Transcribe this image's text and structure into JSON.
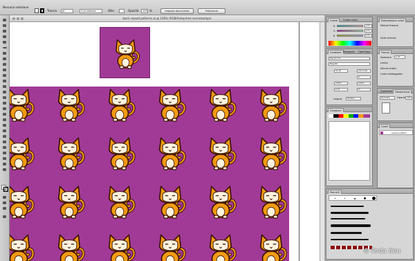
{
  "control_bar": {
    "selection_label": "Nessuna selezione",
    "stroke_label": "Traccia",
    "stroke_weight": "pt",
    "brush_value": "3 pt rotondo",
    "style_label": "Stile",
    "opacity_label": "Opacità",
    "opacity_value": "100",
    "opacity_unit": "%",
    "document_setup_button": "Imposta documento",
    "preferences_button": "Preferenze"
  },
  "document": {
    "title": "basic repeat patterns.ai @ 100% (RGB/Anteprima sovrastampa)"
  },
  "pattern": {
    "background_color": "#a13a96",
    "cat_body_color": "#f29a12",
    "cat_outline_color": "#3a1305",
    "cat_face_color": "#fff4de"
  },
  "panels": {
    "color": {
      "tabs": [
        "Colore",
        "Guida colori"
      ],
      "channels": [
        {
          "label": "R",
          "value": "171"
        },
        {
          "label": "G",
          "value": "171"
        },
        {
          "label": "B",
          "value": "171"
        }
      ]
    },
    "appearance": {
      "tabs": [
        "Elaborazione colori"
      ],
      "items": [
        "Metodi fusione",
        "Stati interval"
      ]
    },
    "character": {
      "tabs": [
        "Carattere",
        "Paragrafo",
        "OpenType"
      ],
      "font": "Myriad Pro",
      "style": "Regular",
      "size": "12 pt",
      "leading": "(14,4 pt)",
      "tracking": "0",
      "scale_h": "100%",
      "scale_v": "100%",
      "baseline": "0 pt",
      "rotation": "0°",
      "language_label": "Lingua:",
      "language_value": "Italiano"
    },
    "stroke": {
      "tabs": [
        "Traccia"
      ],
      "weight_label": "Spessore",
      "weight_value": "1 pt",
      "limit_label": "Limite",
      "align_label": "Allinea tratto",
      "dashed_label": "Linea tratteggiata"
    },
    "transparency": {
      "tabs": [
        "Gradiente",
        "Trasparenza"
      ],
      "mode_value": "Normale",
      "opacity_label": "Opacità",
      "opacity_value": "100"
    },
    "swatches": {
      "tabs": [
        "Campioni"
      ]
    },
    "layers": {
      "tabs": [
        "Livelli"
      ],
      "layer_name": "square pattern"
    },
    "brushes": {
      "tabs": [
        "Pennelli"
      ]
    }
  },
  "watermark": "© linda tieu"
}
